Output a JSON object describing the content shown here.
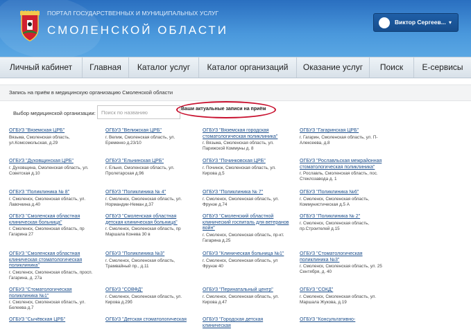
{
  "header": {
    "subtitle": "ПОРТАЛ ГОСУДАРСТВЕННЫХ И МУНИЦИПАЛЬНЫХ УСЛУГ",
    "title": "СМОЛЕНСКОЙ ОБЛАСТИ",
    "user_name": "Виктор Сергеев...",
    "user_caret": "▾"
  },
  "nav": {
    "items": [
      "Личный кабинет",
      "Главная",
      "Каталог услуг",
      "Каталог организаций",
      "Оказание услуг",
      "Поиск",
      "Е-сервисы"
    ]
  },
  "breadcrumb": "Запись на приём в медицинскую организацию Смоленской области",
  "filter": {
    "label": "Выбор медицинской организации:",
    "search_placeholder": "Поиск по названию",
    "appointments_button": "Ваши актуальные записи на приём"
  },
  "organizations": [
    {
      "name": "ОГБУЗ \"Вяземская ЦРБ\"",
      "address": "Вязьма, Смоленская область, ул.Комсомольская, д.29"
    },
    {
      "name": "ОГБУЗ \"Велижская ЦРБ\"",
      "address": "г. Велиж, Смоленская область, ул. Еременко д.23/10"
    },
    {
      "name": "ОГБУЗ \"Вяземская городская стоматологическая поликлиника\"",
      "address": "г. Вязьма, Смоленская область, ул. Парижской Коммуны д. 8"
    },
    {
      "name": "ОГБУЗ \"Гагаринская ЦРБ\"",
      "address": "г. Гагарин, Смоленская область, ул. П-Алексеева, д.8"
    },
    {
      "name": "ОГБУЗ \"Духовщинская ЦРБ\"",
      "address": "г. Духовщина, Смоленская область, ул. Советская д.10"
    },
    {
      "name": "ОГБУЗ \"Ельнинская ЦРБ\"",
      "address": "г. Ельня, Смоленская область, ул. Пролетарская д.96"
    },
    {
      "name": "ОГБУЗ \"Починковская ЦРБ\"",
      "address": "г. Починок, Смоленская область, ул. Кирова д.5"
    },
    {
      "name": "ОГБУЗ \"Рославльская межрайонная стоматологическая поликлиника\"",
      "address": "г. Рославль, Смоленская область, пос. Стеклозавода д. 1"
    },
    {
      "name": "ОГБУЗ \"Поликлиника № 8\"",
      "address": "г. Смоленск, Смоленская область, ул. Лавочкина д.40"
    },
    {
      "name": "ОГБУЗ \"Поликлиника № 4\"",
      "address": "г. Смоленск, Смоленская область, ул. Нормандии-Неман д.37"
    },
    {
      "name": "ОГБУЗ \"Поликлиника № 7\"",
      "address": "г. Смоленск, Смоленская область, ул. Фрунзе д.74"
    },
    {
      "name": "ОГБУЗ \"Поликлиника №6\"",
      "address": "г. Смоленск, Смоленская область, Коммунистическая д.5 А"
    },
    {
      "name": "ОГБУЗ \"Смоленская областная клиническая больница\"",
      "address": "г. Смоленск, Смоленская область, пр Гагарина 27"
    },
    {
      "name": "ОГБУЗ \"Смоленская областная детская клиническая больница\"",
      "address": "г. Смоленск, Смоленская область, пр Маршала Конева 30 в"
    },
    {
      "name": "ОГБУЗ \"Смоленский областной клинический госпиталь для ветеранов войн\"",
      "address": "г. Смоленск, Смоленская область, пр-кт. Гагарина д.25"
    },
    {
      "name": "ОГБУЗ \"Поликлиника № 2\"",
      "address": "г. Смоленск, Смоленская область, пр.Строителей д.15"
    },
    {
      "name": "ОГБУЗ \"Смоленская областная клиническая стоматологическая поликлиника\"",
      "address": "г. Смоленск, Смоленская область, просп. Гагарина, д. 27а"
    },
    {
      "name": "ОГБУЗ \"Поликлиника №3\"",
      "address": "г. Смоленск, Смоленская область, Трамвайный пр., д.11"
    },
    {
      "name": "ОГБУЗ \"Клиническая больница №1\"",
      "address": "г. Смоленск, Смоленская область, ул Фрунзе 40"
    },
    {
      "name": "ОГБУЗ \"Стоматологическая поликлиника №3\"",
      "address": "г. Смоленск, Смоленская область, ул. 25 Сентября, д. 40"
    },
    {
      "name": "ОГБУЗ \"Стоматологическая поликлиника №1\"",
      "address": "г. Смоленск, Смоленская область, ул. Белеева д.7"
    },
    {
      "name": "ОГБУЗ \"СОВФД\"",
      "address": "г. Смоленск, Смоленская область, ул. Кирова д.29б"
    },
    {
      "name": "ОГБУЗ \"Перинатальный центр\"",
      "address": "г. Смоленск, Смоленская область, ул. Кирова д.47"
    },
    {
      "name": "ОГБУЗ \"СОКД\"",
      "address": "г. Смоленск, Смоленская область, ул. Маршала Жукова, д.19"
    },
    {
      "name": "ОГБУЗ \"Сычёвская ЦРБ\"",
      "address": ""
    },
    {
      "name": "ОГБУЗ \"Детская стоматологическая",
      "address": ""
    },
    {
      "name": "ОГБУЗ \"Городская детская клиническая",
      "address": ""
    },
    {
      "name": "ОГБУЗ \"Консультативно-",
      "address": ""
    }
  ],
  "colors": {
    "header_blue": "#3f8ad3",
    "link_blue": "#1d4f8c",
    "highlight_red": "#c8102e",
    "user_button": "#1b569a"
  },
  "icons": {
    "emblem": "smolensk-coat-of-arms-icon",
    "avatar": "user-avatar-icon",
    "caret": "chevron-down-icon"
  }
}
